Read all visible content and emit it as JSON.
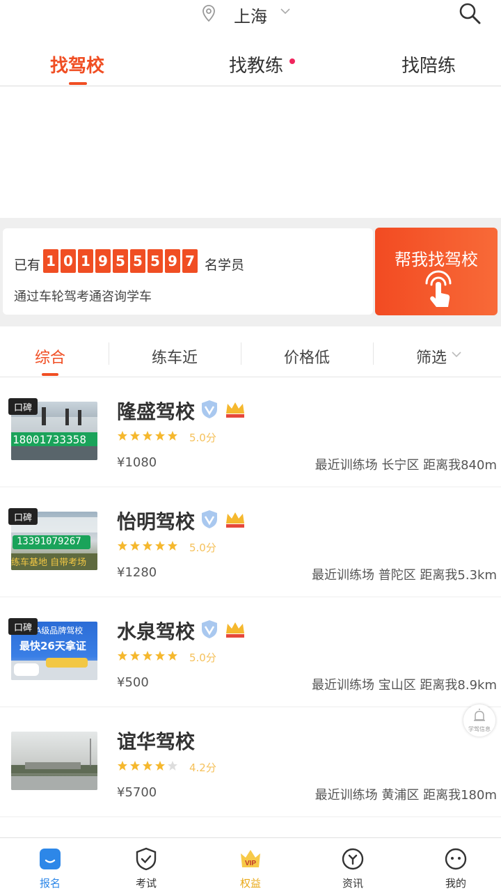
{
  "header": {
    "city": "上海",
    "tabs": [
      {
        "label": "找驾校"
      },
      {
        "label": "找教练"
      },
      {
        "label": "找陪练"
      }
    ]
  },
  "count_card": {
    "prefix": "已有",
    "digits": [
      "1",
      "0",
      "1",
      "9",
      "5",
      "5",
      "5",
      "9",
      "7"
    ],
    "suffix": "名学员",
    "subtitle": "通过车轮驾考通咨询学车",
    "button_label": "帮我找驾校"
  },
  "sort": {
    "items": [
      {
        "label": "综合"
      },
      {
        "label": "练车近"
      },
      {
        "label": "价格低"
      },
      {
        "label": "筛选"
      }
    ]
  },
  "schools": [
    {
      "badge": "口碑",
      "name": "隆盛驾校",
      "rating_text": "5.0分",
      "stars": 5,
      "price": "¥1080",
      "location": "最近训练场 长宁区 距离我840m",
      "thumb_text": "18001733358"
    },
    {
      "badge": "口碑",
      "name": "怡明驾校",
      "rating_text": "5.0分",
      "stars": 5,
      "price": "¥1280",
      "location": "最近训练场 普陀区 距离我5.3km",
      "thumb_text": "13391079267",
      "thumb_text2": "练车基地 自带考场"
    },
    {
      "badge": "口碑",
      "name": "水泉驾校",
      "rating_text": "5.0分",
      "stars": 5,
      "price": "¥500",
      "location": "最近训练场 宝山区 距离我8.9km",
      "thumb_text": "AAA级品牌驾校",
      "thumb_text2": "最快26天拿证"
    },
    {
      "name": "谊华驾校",
      "rating_text": "4.2分",
      "stars": 4,
      "price": "¥5700",
      "location": "最近训练场 黄浦区 距离我180m"
    }
  ],
  "float_button": {
    "label": "学驾信息"
  },
  "bottom_nav": [
    {
      "label": "报名"
    },
    {
      "label": "考试"
    },
    {
      "label": "权益",
      "badge": "VIP"
    },
    {
      "label": "资讯"
    },
    {
      "label": "我的"
    }
  ],
  "colors": {
    "accent": "#f04e23",
    "nav_active": "#2d87e8",
    "star": "#f5b82e",
    "vip": "#e9a817"
  }
}
